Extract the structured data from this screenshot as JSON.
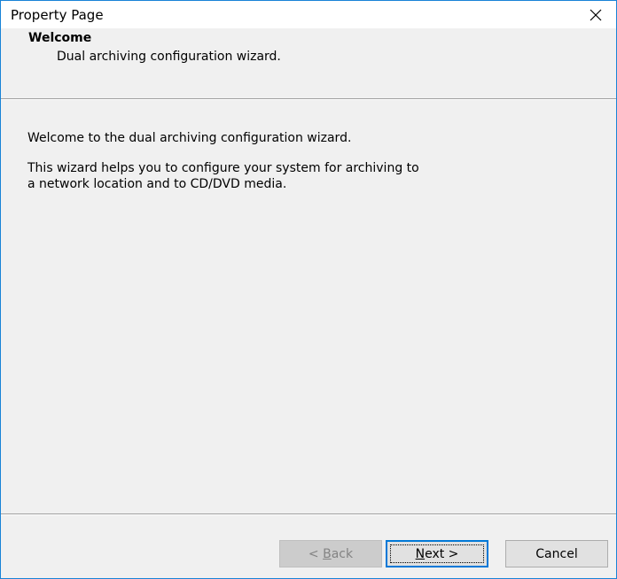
{
  "window": {
    "title": "Property Page",
    "close_icon": "close-icon"
  },
  "header": {
    "title": "Welcome",
    "subtitle": "Dual archiving configuration wizard."
  },
  "content": {
    "line1": "Welcome to the dual archiving configuration wizard.",
    "line2a": "This wizard helps you to configure your system for archiving to",
    "line2b": "a network location and to CD/DVD media."
  },
  "buttons": {
    "back_lt": "< ",
    "back_accel": "B",
    "back_rest": "ack",
    "next_accel": "N",
    "next_rest": "ext >",
    "cancel": "Cancel"
  },
  "colors": {
    "window_border": "#1883d7",
    "dialog_bg": "#f0f0f0",
    "focus_border": "#0078d7"
  }
}
